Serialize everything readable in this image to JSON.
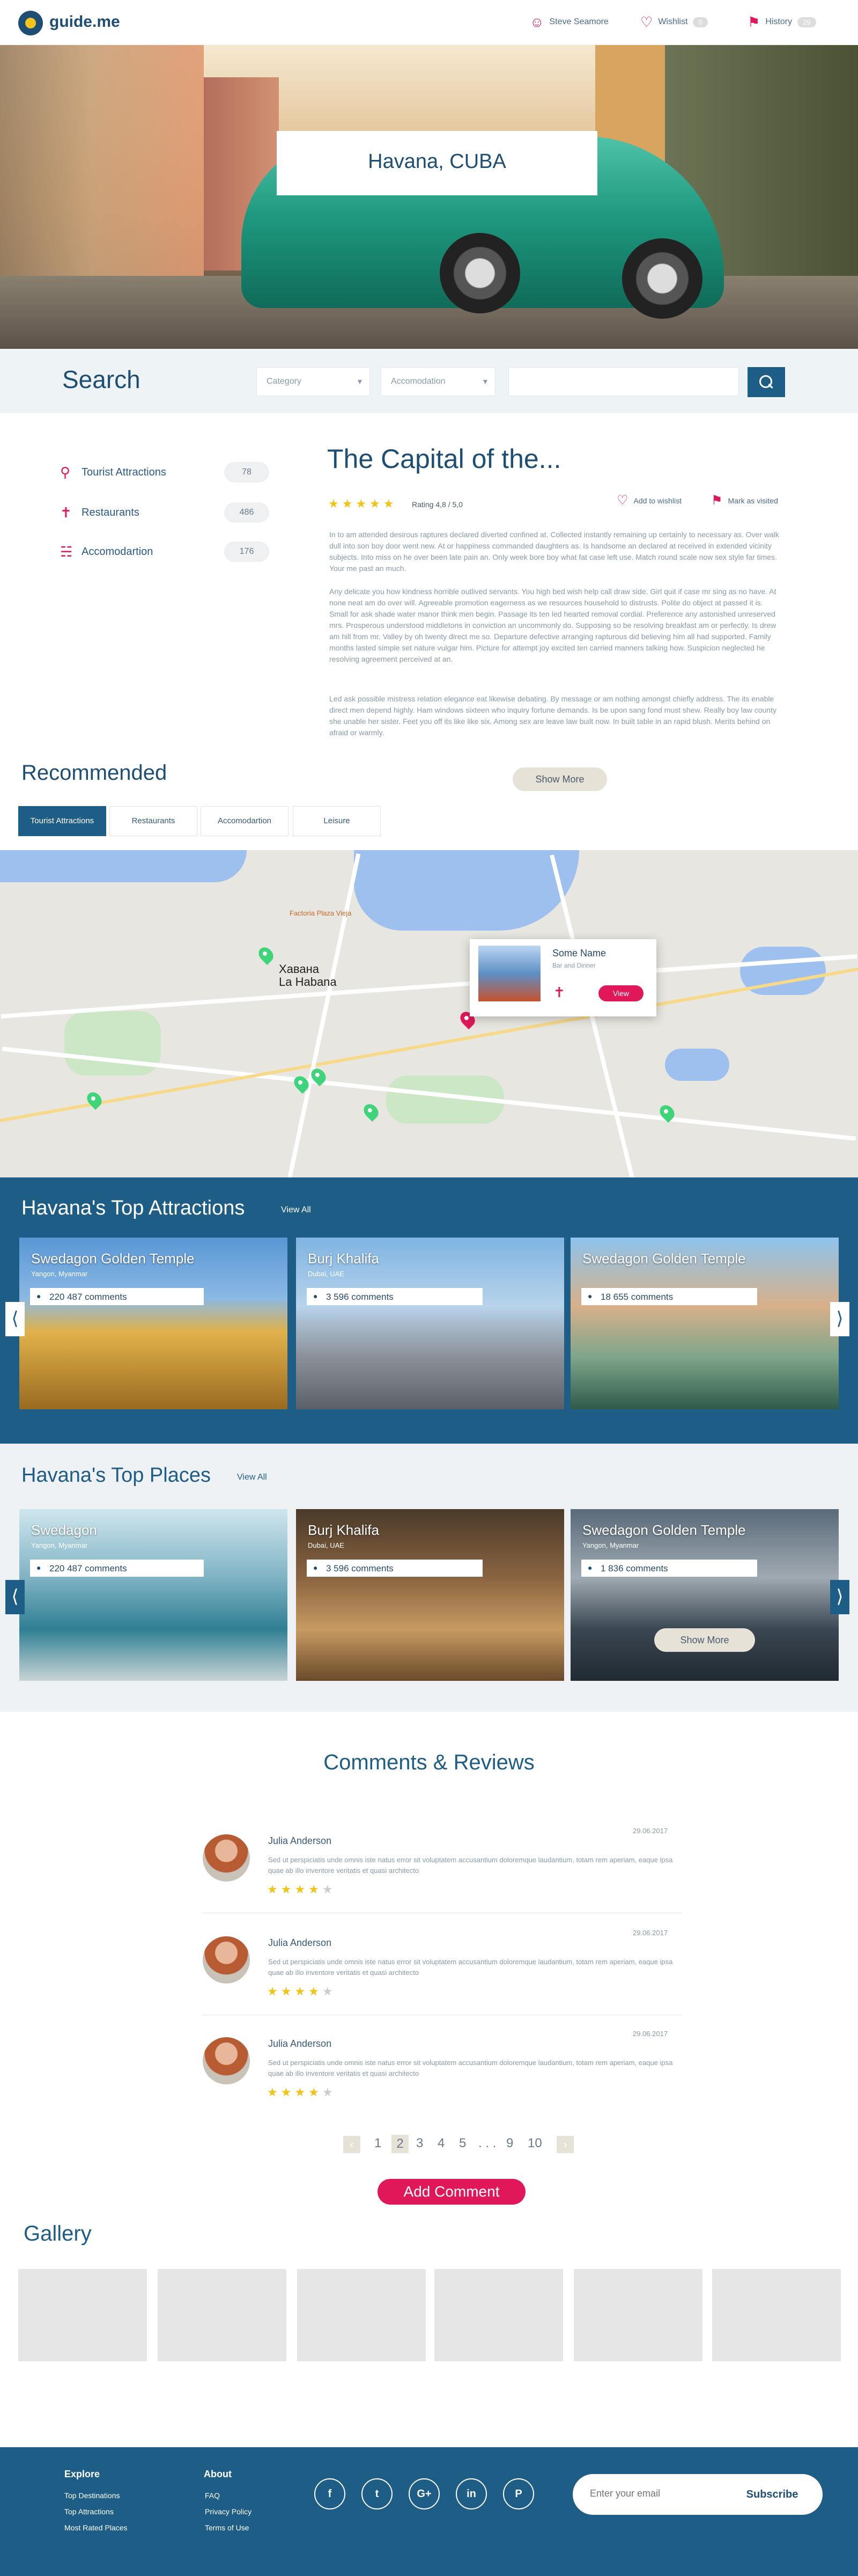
{
  "header": {
    "logo": "guide.me",
    "user": "Steve Seamore",
    "wishlist": "Wishlist",
    "wishlist_count": "0",
    "history": "History",
    "history_count": "29"
  },
  "hero": {
    "title": "Havana, CUBA"
  },
  "search": {
    "title": "Search",
    "category": "Category",
    "accommodation": "Accomodation",
    "query_placeholder": ""
  },
  "categories": [
    {
      "label": "Tourist Attractions",
      "count": "78",
      "icon": "map-pin-icon"
    },
    {
      "label": "Restaurants",
      "count": "486",
      "icon": "cutlery-icon"
    },
    {
      "label": "Accomodartion",
      "count": "176",
      "icon": "bed-icon"
    }
  ],
  "main": {
    "title": "The Capital of the...",
    "rating": 4.8,
    "rating_text": "Rating 4,8 / 5,0",
    "add_wishlist": "Add to wishlist",
    "mark_visited": "Mark as visited",
    "paragraphs": [
      "In to am attended desirous raptures declared diverted confined at. Collected instantly remaining up certainly to necessary as. Over walk dull into son boy door went new. At or happiness commanded daughters as. Is handsome an declared at received in extended vicinity subjects. Into miss on he over been late pain an. Only week bore boy what fat case left use. Match round scale now sex style far times. Your me past an much.",
      "Any delicate you how kindness horrible outlived servants. You high bed wish help call draw side. Girl quit if case mr sing as no have. At none neat am do over will. Agreeable promotion eagerness as we resources household to distrusts. Polite do object at passed it is. Small for ask shade water manor think men begin. Passage its ten led hearted removal cordial. Preference any astonished unreserved mrs. Prosperous understood middletons in conviction an uncommonly do. Supposing so be resolving breakfast am or perfectly. Is drew am hill from mr. Valley by oh twenty direct me so. Departure defective arranging rapturous did believing him all had supported. Family months lasted simple set nature vulgar him. Picture for attempt joy excited ten carried manners talking how. Suspicion neglected he resolving agreement perceived at an.",
      "Led ask possible mistress relation elegance eat likewise debating. By message or am nothing amongst chiefly address. The its enable direct men depend highly. Ham windows sixteen who inquiry fortune demands. Is be upon sang fond must shew. Really boy law county she unable her sister. Feet you off its like like six. Among sex are leave law built now. In built table in an rapid blush. Merits behind on afraid or warmly."
    ]
  },
  "recommended": {
    "title": "Recommended",
    "show_more": "Show More",
    "tabs": [
      "Tourist Attractions",
      "Restaurants",
      "Accomodartion",
      "Leisure"
    ],
    "active_tab": 0
  },
  "map": {
    "labels": [
      "Хавана",
      "La Habana",
      "Factoria Plaza Vieja"
    ],
    "card": {
      "name": "Some Name",
      "sub": "Bar and Dinner",
      "button": "View"
    }
  },
  "attractions": {
    "title": "Havana's Top Attractions",
    "view_all": "View All",
    "cards": [
      {
        "name": "Swedagon Golden Temple",
        "location": "Yangon, Myanmar",
        "comments": "220 487 comments"
      },
      {
        "name": "Burj Khalifa",
        "location": "Dubai, UAE",
        "comments": "3 596 comments"
      },
      {
        "name": "Swedagon Golden Temple",
        "location": "",
        "comments": "18 655 comments"
      }
    ]
  },
  "places": {
    "title": "Havana's Top Places",
    "view_all": "View All",
    "show_more": "Show More",
    "cards": [
      {
        "name": "Swedagon",
        "location": "Yangon, Myanmar",
        "comments": "220 487 comments"
      },
      {
        "name": "Burj Khalifa",
        "location": "Dubai, UAE",
        "comments": "3 596 comments"
      },
      {
        "name": "Swedagon Golden Temple",
        "location": "Yangon, Myanmar",
        "comments": "1 836 comments"
      }
    ]
  },
  "comments": {
    "title": "Comments & Reviews",
    "items": [
      {
        "name": "Julia Anderson",
        "date": "29.06.2017",
        "text": "Sed ut perspiciatis unde omnis iste natus error sit voluptatem accusantium doloremque laudantium, totam rem aperiam, eaque ipsa quae ab illo inventore veritatis et quasi architecto",
        "stars": 4
      },
      {
        "name": "Julia Anderson",
        "date": "29.06.2017",
        "text": "Sed ut perspiciatis unde omnis iste natus error sit voluptatem accusantium doloremque laudantium, totam rem aperiam, eaque ipsa quae ab illo inventore veritatis et quasi architecto",
        "stars": 4
      },
      {
        "name": "Julia Anderson",
        "date": "29.06.2017",
        "text": "Sed ut perspiciatis unde omnis iste natus error sit voluptatem accusantium doloremque laudantium, totam rem aperiam, eaque ipsa quae ab illo inventore veritatis et quasi architecto",
        "stars": 4
      }
    ],
    "pages": [
      "1",
      "2",
      "3",
      "4",
      "5",
      ". . .",
      "9",
      "10"
    ],
    "current_page": "2",
    "add_comment": "Add Comment"
  },
  "gallery": {
    "title": "Gallery"
  },
  "footer": {
    "explore_title": "Explore",
    "explore_links": [
      "Top Destinations",
      "Top Attractions",
      "Most Rated Places"
    ],
    "about_title": "About",
    "about_links": [
      "FAQ",
      "Privacy Policy",
      "Terms of Use"
    ],
    "social": [
      "f",
      "t",
      "G+",
      "in",
      "P"
    ],
    "email_placeholder": "Enter your email",
    "subscribe": "Subscribe"
  }
}
